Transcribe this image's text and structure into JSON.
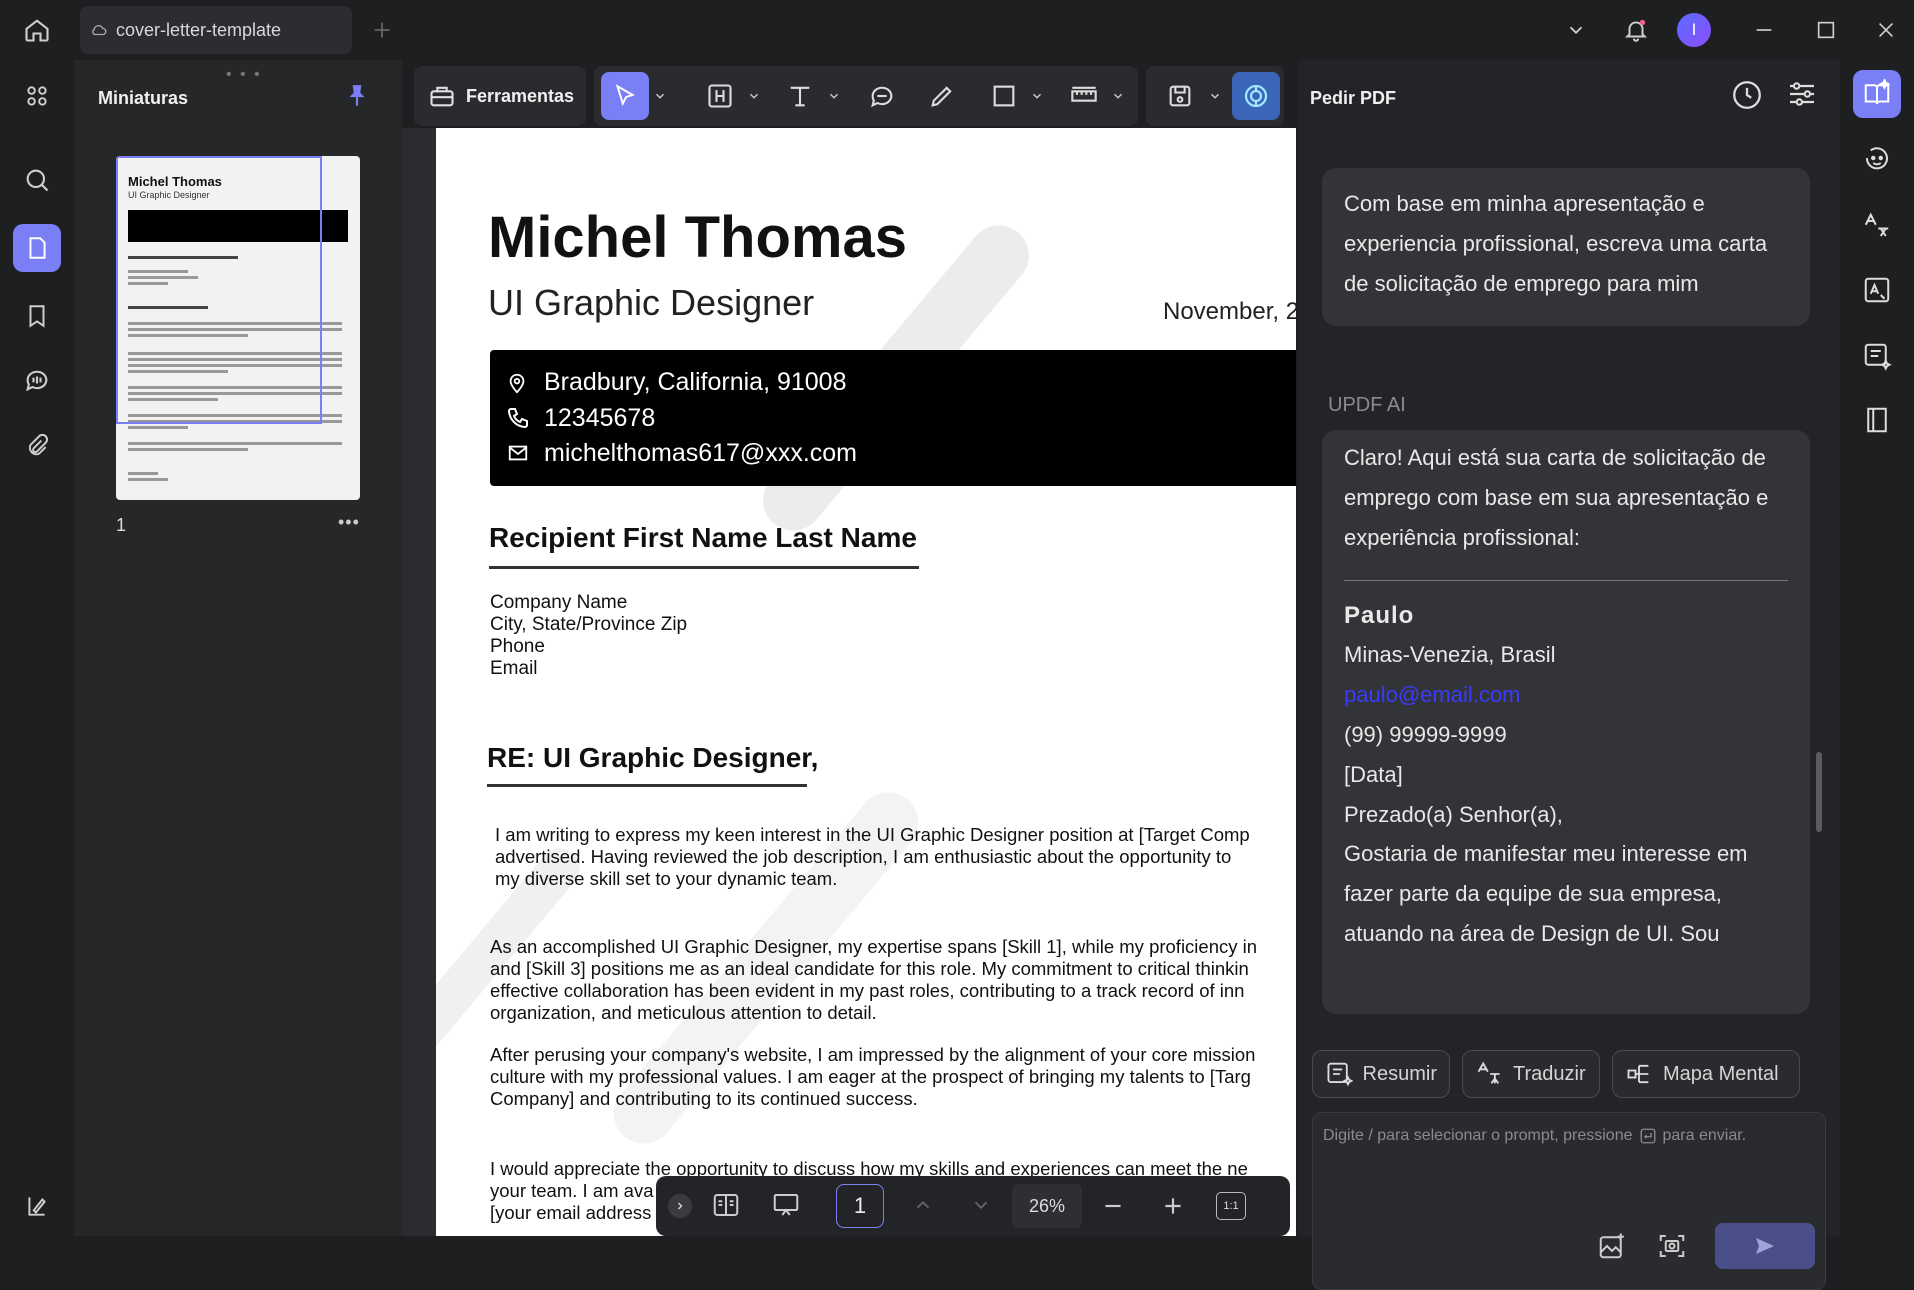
{
  "tab": {
    "title": "cover-letter-template"
  },
  "thumbnails": {
    "title": "Miniaturas",
    "page_number": "1",
    "thumb_name": "Michel Thomas",
    "thumb_role": "UI Graphic Designer"
  },
  "toolbar": {
    "tools_label": "Ferramentas"
  },
  "document": {
    "name": "Michel Thomas",
    "role": "UI Graphic Designer",
    "date": "November, 2",
    "address": "Bradbury, California, 91008",
    "phone": "12345678",
    "email": "michelthomas617@xxx.com",
    "recipient_heading": "Recipient First Name Last Name",
    "company_lines": [
      "Company Name",
      "City, State/Province Zip",
      "Phone",
      "Email"
    ],
    "re_heading": "RE: UI Graphic Designer,",
    "para1": [
      "I am writing to express my keen interest in the UI Graphic Designer position at [Target Comp",
      "advertised. Having reviewed the job description, I am enthusiastic about the opportunity to",
      "my diverse skill set to your dynamic team."
    ],
    "para2": [
      "As an accomplished UI Graphic Designer, my expertise spans [Skill 1], while my proficiency in",
      "and [Skill 3] positions me as an ideal candidate for this role. My commitment to critical thinkin",
      "effective collaboration has been evident in my past roles, contributing to a track record of inn",
      "organization, and meticulous attention to detail."
    ],
    "para3": [
      "After perusing your company's website, I am impressed by the alignment of your core mission",
      "culture with my professional values. I am eager at the prospect of bringing my talents to [Targ",
      "Company] and contributing to its continued success."
    ],
    "para4": [
      "I would appreciate the opportunity to discuss how my skills and experiences can meet the ne",
      "your team. I am ava",
      "[your email address"
    ]
  },
  "bottom_nav": {
    "page_value": "1",
    "zoom": "26%",
    "fit_label": "1:1"
  },
  "ai_panel": {
    "title": "Pedir PDF",
    "user_message": "Com base em minha apresentação e experiencia profissional, escreva uma carta de solicitação de emprego para mim",
    "ai_label": "UPDF AI",
    "ai_intro": "Claro! Aqui está sua carta de solicitação de emprego com base em sua apresentação e experiência profissional:",
    "letter_name": "Paulo",
    "letter_city": "Minas-Venezia, Brasil",
    "letter_email": "paulo@email.com",
    "letter_phone": "(99) 99999-9999",
    "letter_date": "[Data]",
    "letter_greeting": "Prezado(a) Senhor(a),",
    "letter_body": "Gostaria de manifestar meu interesse em fazer parte da equipe de sua empresa, atuando na área de Design de UI. Sou",
    "chips": [
      "Resumir",
      "Traduzir",
      "Mapa Mental"
    ],
    "input_placeholder": "Digite / para selecionar o prompt, pressione",
    "input_suffix": "para enviar."
  },
  "colors": {
    "accent": "#7a7ff5",
    "link": "#3b3bff",
    "send": "#4a4f8a"
  }
}
